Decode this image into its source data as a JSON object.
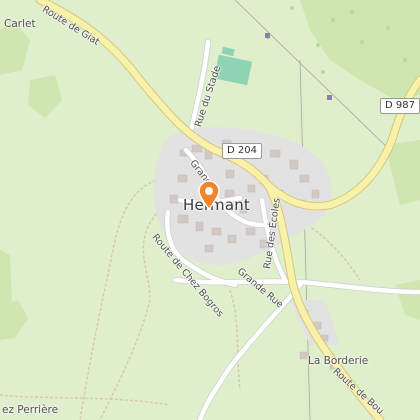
{
  "map": {
    "town": "Hermant",
    "roads": {
      "route_de_giat": "Route de Giat",
      "rue_du_stade": "Rue du Stade",
      "grande_rue_north": "Grande",
      "grande_rue": "Grande Rue",
      "route_de_chez_bogros": "Route de Chez Bogros",
      "rue_des_ecoles": "Rue des Écoles",
      "route_de_bou": "Route de Bou"
    },
    "road_shields": {
      "d204": "D 204",
      "d987": "D 987"
    },
    "places": {
      "carlet": "Carlet",
      "la_borderie": "La Borderie",
      "perriere": "ez Perrière"
    },
    "marker_icon": "location-pin-icon",
    "colors": {
      "background": "#dfeecb",
      "forest": "#cfe6b0",
      "major_road": "#f7f1a9",
      "road_casing": "#d8c77a",
      "built_area": "#e2e2e2",
      "buildings": "#d2c9c5",
      "pitch": "#8fd3b5",
      "marker": "#f0852e"
    }
  }
}
